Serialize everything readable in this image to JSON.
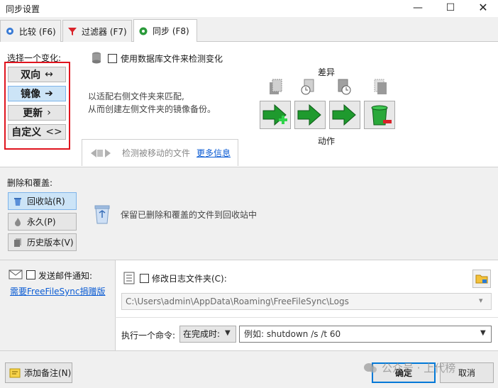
{
  "window": {
    "title": "同步设置",
    "min_glyph": "—",
    "max_glyph": "☐",
    "close_glyph": "✕"
  },
  "tabs": [
    {
      "label": "比较 (F6)",
      "icon": "gear-blue-icon",
      "active": false
    },
    {
      "label": "过滤器 (F7)",
      "icon": "funnel-icon",
      "active": false
    },
    {
      "label": "同步 (F8)",
      "icon": "gear-green-icon",
      "active": true
    }
  ],
  "variant": {
    "label": "选择一个变化:",
    "options": [
      {
        "label": "双向",
        "glyph": "↔",
        "selected": false
      },
      {
        "label": "镜像",
        "glyph": "➔",
        "selected": true
      },
      {
        "label": "更新",
        "glyph": "›",
        "selected": false
      },
      {
        "label": "自定义",
        "glyph": "<>",
        "selected": false
      }
    ]
  },
  "database": {
    "label": "使用数据库文件来检测变化",
    "checked": false
  },
  "description": {
    "line1": "以适配右侧文件夹来匹配,",
    "line2": "从而创建左侧文件夹的镜像备份。"
  },
  "differences": {
    "label": "差异",
    "categories": [
      "left-only-icon",
      "left-newer-icon",
      "right-newer-icon",
      "right-only-icon"
    ]
  },
  "actions": {
    "label": "动作",
    "items": [
      "create-right-icon",
      "update-right-icon",
      "update-right-icon",
      "delete-right-icon"
    ]
  },
  "moved": {
    "text": "检测被移动的文件",
    "link": "更多信息"
  },
  "deletion": {
    "label": "删除和覆盖:",
    "options": [
      {
        "label": "回收站(R)",
        "selected": true
      },
      {
        "label": "永久(P)",
        "selected": false
      },
      {
        "label": "历史版本(V)",
        "selected": false
      }
    ],
    "description": "保留已删除和覆盖的文件到回收站中"
  },
  "email": {
    "label": "发送邮件通知:",
    "checked": false,
    "link": "需要FreeFileSync捐赠版"
  },
  "log": {
    "label": "修改日志文件夹(C):",
    "checked": false,
    "path": "C:\\Users\\admin\\AppData\\Roaming\\FreeFileSync\\Logs"
  },
  "command": {
    "label": "执行一个命令:",
    "when": "在完成时:",
    "placeholder": "例如: shutdown /s /t 60"
  },
  "footer": {
    "note_label": "添加备注(N)",
    "ok_label": "确定",
    "cancel_label": "取消"
  },
  "watermark": {
    "text": "公众号 · 上代榜"
  },
  "colors": {
    "accent": "#0078d7",
    "selected_bg": "#cce4f7",
    "highlight_border": "#e0141e",
    "link": "#0a5bd3",
    "action_green": "#1f9a2e"
  }
}
